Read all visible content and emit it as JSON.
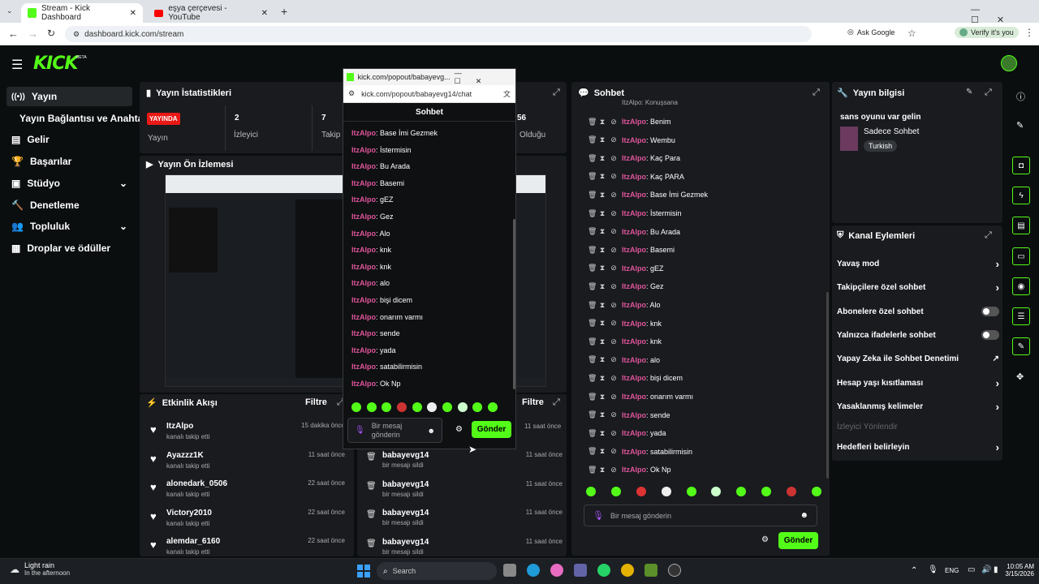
{
  "browser": {
    "tabs": [
      {
        "title": "Stream - Kick Dashboard",
        "active": true
      },
      {
        "title": "eşya çerçevesi - YouTube",
        "active": false
      }
    ],
    "url": "dashboard.kick.com/stream",
    "ask_google": "Ask Google",
    "verify": "Verify it's you"
  },
  "kick": {
    "logo": "KICK",
    "logo_badge": "BETA"
  },
  "sidebar": {
    "items": [
      {
        "label": "Yayın",
        "icon": "broadcast-icon"
      },
      {
        "label": "Yayın Bağlantısı ve Anahtarı",
        "icon": ""
      },
      {
        "label": "Gelir",
        "icon": "revenue-icon"
      },
      {
        "label": "Başarılar",
        "icon": "trophy-icon"
      },
      {
        "label": "Stüdyo",
        "icon": "studio-icon"
      },
      {
        "label": "Denetleme",
        "icon": "moderation-icon"
      },
      {
        "label": "Topluluk",
        "icon": "community-icon"
      },
      {
        "label": "Droplar ve ödüller",
        "icon": "drops-icon"
      }
    ]
  },
  "stats": {
    "title": "Yayın İstatistikleri",
    "live_badge": "YAYINDA",
    "stream_label": "Yayın",
    "viewers_value": "2",
    "viewers_label": "İzleyici",
    "followers_value": "7",
    "followers_label": "Takip",
    "duration_value": "56",
    "duration_label": "Olduğu"
  },
  "preview": {
    "title": "Yayın Ön İzlemesi"
  },
  "events": {
    "title": "Etkinlik Akışı",
    "filter": "Filtre",
    "items": [
      {
        "name": "ItzAlpo",
        "action": "kanalı takip etti",
        "time": "15 dakika önce"
      },
      {
        "name": "Ayazzz1K",
        "action": "kanalı takip etti",
        "time": "11 saat önce"
      },
      {
        "name": "alonedark_0506",
        "action": "kanalı takip etti",
        "time": "22 saat önce"
      },
      {
        "name": "Victory2010",
        "action": "kanalı takip etti",
        "time": "22 saat önce"
      },
      {
        "name": "alemdar_6160",
        "action": "kanalı takip etti",
        "time": "22 saat önce"
      }
    ]
  },
  "modlog": {
    "filter": "Filtre",
    "first_time": "11 saat önce",
    "items": [
      {
        "name": "babayevg14",
        "action": "bir mesajı sildi",
        "time": "11 saat önce"
      },
      {
        "name": "babayevg14",
        "action": "bir mesajı sildi",
        "time": "11 saat önce"
      },
      {
        "name": "babayevg14",
        "action": "bir mesajı sildi",
        "time": "11 saat önce"
      },
      {
        "name": "babayevg14",
        "action": "bir mesajı sildi",
        "time": "11 saat önce"
      }
    ]
  },
  "popup": {
    "title": "kick.com/popout/babayevg...",
    "url": "kick.com/popout/babayevg14/chat",
    "header": "Sohbet",
    "messages": [
      {
        "user": "ItzAlpo",
        "text": ": Base İmi Gezmek"
      },
      {
        "user": "ItzAlpo",
        "text": ": İstermisin"
      },
      {
        "user": "ItzAlpo",
        "text": ": Bu Arada"
      },
      {
        "user": "ItzAlpo",
        "text": ": Basemi"
      },
      {
        "user": "ItzAlpo",
        "text": ": gEZ"
      },
      {
        "user": "ItzAlpo",
        "text": ": Gez"
      },
      {
        "user": "ItzAlpo",
        "text": ": Alo"
      },
      {
        "user": "ItzAlpo",
        "text": ": knk"
      },
      {
        "user": "ItzAlpo",
        "text": ": knk"
      },
      {
        "user": "ItzAlpo",
        "text": ": alo"
      },
      {
        "user": "ItzAlpo",
        "text": ": bişi dicem"
      },
      {
        "user": "ItzAlpo",
        "text": ": onarım varmı"
      },
      {
        "user": "ItzAlpo",
        "text": ": sende"
      },
      {
        "user": "ItzAlpo",
        "text": ": yada"
      },
      {
        "user": "ItzAlpo",
        "text": ": satabilirmisin"
      },
      {
        "user": "ItzAlpo",
        "text": ": Ok Np"
      }
    ],
    "placeholder": "Bir mesaj gönderin",
    "send": "Gönder"
  },
  "chat": {
    "title": "Sohbet",
    "top_partial": "ItzAlpo: Konuşsana",
    "messages": [
      {
        "user": "ItzAlpo",
        "text": ": Benim"
      },
      {
        "user": "ItzAlpo",
        "text": ": Wembu"
      },
      {
        "user": "ItzAlpo",
        "text": ": Kaç Para"
      },
      {
        "user": "ItzAlpo",
        "text": ": Kaç PARA"
      },
      {
        "user": "ItzAlpo",
        "text": ": Base İmi Gezmek"
      },
      {
        "user": "ItzAlpo",
        "text": ": İstermisin"
      },
      {
        "user": "ItzAlpo",
        "text": ": Bu Arada"
      },
      {
        "user": "ItzAlpo",
        "text": ": Basemi"
      },
      {
        "user": "ItzAlpo",
        "text": ": gEZ"
      },
      {
        "user": "ItzAlpo",
        "text": ": Gez"
      },
      {
        "user": "ItzAlpo",
        "text": ": Alo"
      },
      {
        "user": "ItzAlpo",
        "text": ": knk"
      },
      {
        "user": "ItzAlpo",
        "text": ": knk"
      },
      {
        "user": "ItzAlpo",
        "text": ": alo"
      },
      {
        "user": "ItzAlpo",
        "text": ": bişi dicem"
      },
      {
        "user": "ItzAlpo",
        "text": ": onarım varmı"
      },
      {
        "user": "ItzAlpo",
        "text": ": sende"
      },
      {
        "user": "ItzAlpo",
        "text": ": yada"
      },
      {
        "user": "ItzAlpo",
        "text": ": satabilirmisin"
      },
      {
        "user": "ItzAlpo",
        "text": ": Ok Np"
      }
    ],
    "placeholder": "Bir mesaj gönderin",
    "send": "Gönder"
  },
  "stream_info": {
    "title": "Yayın bilgisi",
    "stream_title": "sans oyunu var gelin",
    "category": "Sadece Sohbet",
    "language": "Turkish"
  },
  "channel_actions": {
    "title": "Kanal Eylemleri",
    "items": [
      {
        "label": "Yavaş mod",
        "control": "chevron"
      },
      {
        "label": "Takipçilere özel sohbet",
        "control": "chevron"
      },
      {
        "label": "Abonelere özel sohbet",
        "control": "toggle"
      },
      {
        "label": "Yalnızca ifadelerle sohbet",
        "control": "toggle"
      },
      {
        "label": "Yapay Zeka ile Sohbet Denetimi",
        "control": "external"
      },
      {
        "label": "Hesap yaşı kısıtlaması",
        "control": "chevron"
      },
      {
        "label": "Yasaklanmış kelimeler",
        "control": "chevron"
      },
      {
        "label": "İzleyici Yönlendir",
        "control": "none"
      },
      {
        "label": "Hedefleri belirleyin",
        "control": "chevron"
      }
    ]
  },
  "taskbar": {
    "weather": "Light rain",
    "weather_sub": "In the afternoon",
    "search": "Search",
    "lang": "ENG",
    "time": "10:05 AM",
    "date": "3/15/2026"
  },
  "colors": {
    "accent": "#53fc18",
    "live": "#e91916",
    "username": "#e0559a"
  }
}
